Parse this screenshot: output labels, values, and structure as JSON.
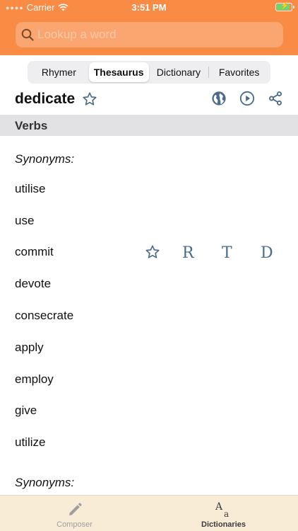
{
  "status_bar": {
    "carrier": "Carrier",
    "time": "3:51 PM"
  },
  "search": {
    "placeholder": "Lookup a word"
  },
  "segments": [
    {
      "label": "Rhymer",
      "active": false
    },
    {
      "label": "Thesaurus",
      "active": true
    },
    {
      "label": "Dictionary",
      "active": false
    },
    {
      "label": "Favorites",
      "active": false
    }
  ],
  "entry": {
    "word": "dedicate"
  },
  "section": {
    "title": "Verbs"
  },
  "synonyms": {
    "label": "Synonyms:",
    "items": [
      "utilise",
      "use",
      "commit",
      "devote",
      "consecrate",
      "apply",
      "employ",
      "give",
      "utilize"
    ],
    "second_label": "Synonyms:"
  },
  "row_actions": {
    "rhymer": "R",
    "thesaurus": "T",
    "dictionary": "D"
  },
  "tabbar": {
    "composer": "Composer",
    "dictionaries": "Dictionaries"
  },
  "colors": {
    "header": "#f98b45",
    "accent": "#4a6b8a",
    "tabbar": "#f9ecd7"
  }
}
